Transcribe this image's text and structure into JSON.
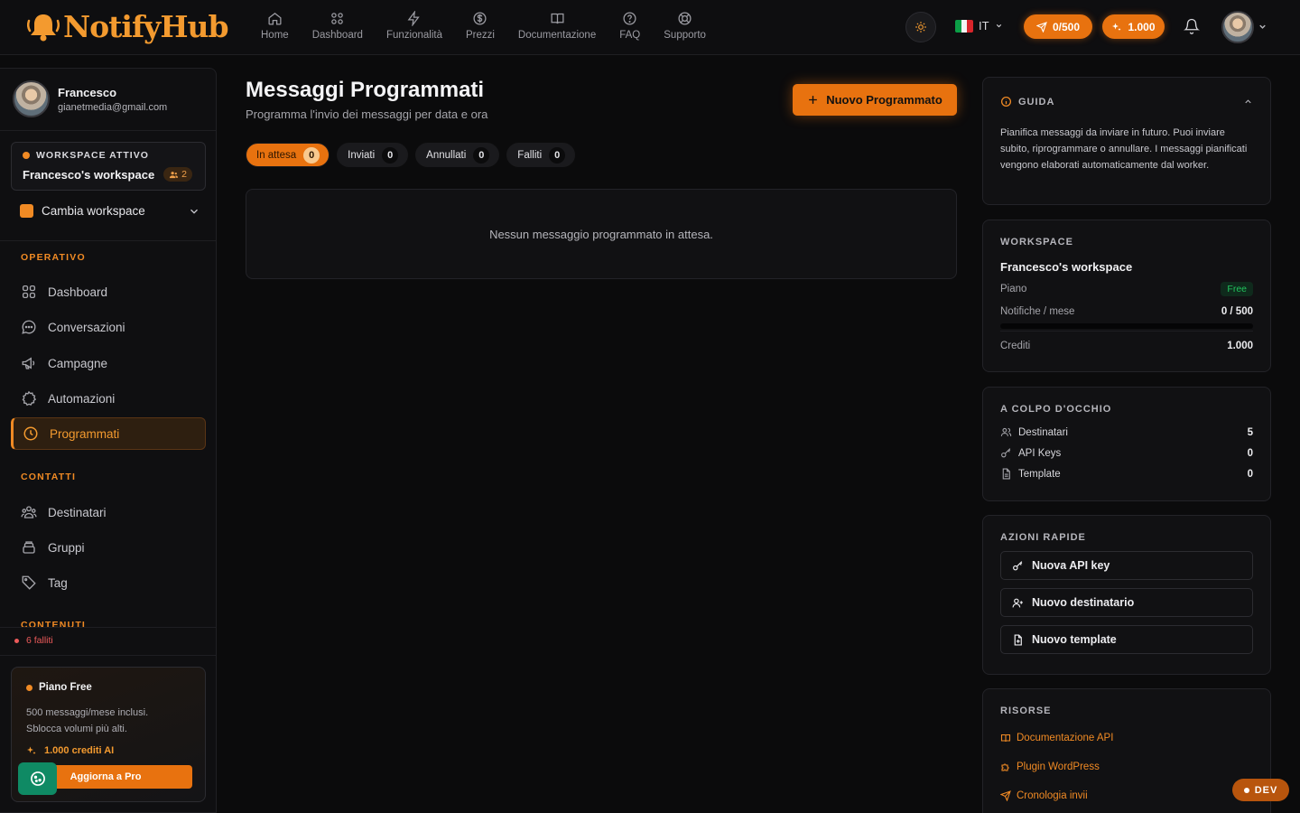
{
  "brand": {
    "name": "NotifyHub"
  },
  "nav": [
    {
      "label": "Home",
      "icon": "home-icon"
    },
    {
      "label": "Dashboard",
      "icon": "grid-icon"
    },
    {
      "label": "Funzionalità",
      "icon": "bolt-icon"
    },
    {
      "label": "Prezzi",
      "icon": "dollar-icon"
    },
    {
      "label": "Documentazione",
      "icon": "book-icon"
    },
    {
      "label": "FAQ",
      "icon": "help-icon"
    },
    {
      "label": "Supporto",
      "icon": "lifebuoy-icon"
    }
  ],
  "topbar": {
    "language": "IT",
    "messages_quota": "0/500",
    "credits": "1.000"
  },
  "user": {
    "name": "Francesco",
    "email": "gianetmedia@gmail.com"
  },
  "workspace": {
    "tag": "WORKSPACE ATTIVO",
    "name": "Francesco's workspace",
    "members": "2",
    "switch_label": "Cambia workspace"
  },
  "sidebar": {
    "section_operativo": "OPERATIVO",
    "section_contatti": "CONTATTI",
    "section_contenuti": "CONTENUTI",
    "operativo": [
      {
        "label": "Dashboard",
        "icon": "grid-icon"
      },
      {
        "label": "Conversazioni",
        "icon": "chat-icon"
      },
      {
        "label": "Campagne",
        "icon": "megaphone-icon"
      },
      {
        "label": "Automazioni",
        "icon": "gear-icon"
      },
      {
        "label": "Programmati",
        "icon": "clock-icon",
        "active": true
      }
    ],
    "contatti": [
      {
        "label": "Destinatari",
        "icon": "users-icon"
      },
      {
        "label": "Gruppi",
        "icon": "layers-icon"
      },
      {
        "label": "Tag",
        "icon": "tag-icon"
      }
    ],
    "failed": "6 falliti"
  },
  "plan": {
    "title": "Piano Free",
    "desc": "500 messaggi/mese inclusi. Sblocca volumi più alti.",
    "credits": "1.000 crediti AI",
    "upgrade": "Aggiorna a Pro"
  },
  "main": {
    "title": "Messaggi Programmati",
    "subtitle": "Programma l'invio dei messaggi per data e ora",
    "new_button": "Nuovo Programmato",
    "tabs": [
      {
        "label": "In attesa",
        "count": "0",
        "active": true
      },
      {
        "label": "Inviati",
        "count": "0"
      },
      {
        "label": "Annullati",
        "count": "0"
      },
      {
        "label": "Falliti",
        "count": "0"
      }
    ],
    "empty_text": "Nessun messaggio programmato in attesa."
  },
  "guide": {
    "title": "GUIDA",
    "text": "Pianifica messaggi da inviare in futuro. Puoi inviare subito, riprogrammare o annullare. I messaggi pianificati vengono elaborati automaticamente dal worker."
  },
  "ws_card": {
    "title": "WORKSPACE",
    "name": "Francesco's workspace",
    "plan_label": "Piano",
    "plan_value": "Free",
    "notif_label": "Notifiche / mese",
    "notif_value": "0 / 500",
    "notif_fraction": 0,
    "credits_label": "Crediti",
    "credits_value": "1.000"
  },
  "glance": {
    "title": "A COLPO D'OCCHIO",
    "rows": [
      {
        "label": "Destinatari",
        "value": "5",
        "icon": "users-icon"
      },
      {
        "label": "API Keys",
        "value": "0",
        "icon": "key-icon"
      },
      {
        "label": "Template",
        "value": "0",
        "icon": "file-icon"
      }
    ]
  },
  "quick": {
    "title": "AZIONI RAPIDE",
    "buttons": [
      {
        "label": "Nuova API key",
        "icon": "key-icon"
      },
      {
        "label": "Nuovo destinatario",
        "icon": "user-plus-icon"
      },
      {
        "label": "Nuovo template",
        "icon": "file-plus-icon"
      }
    ]
  },
  "resources": {
    "title": "RISORSE",
    "links": [
      {
        "label": "Documentazione API",
        "icon": "book-icon"
      },
      {
        "label": "Plugin WordPress",
        "icon": "puzzle-icon"
      },
      {
        "label": "Cronologia invii",
        "icon": "send-icon"
      }
    ]
  },
  "dev_badge": "DEV",
  "colors": {
    "accent": "#e8720f",
    "background": "#0b0b0c",
    "panel": "#111113",
    "danger": "#ec5a5a",
    "success": "#22c55e"
  }
}
